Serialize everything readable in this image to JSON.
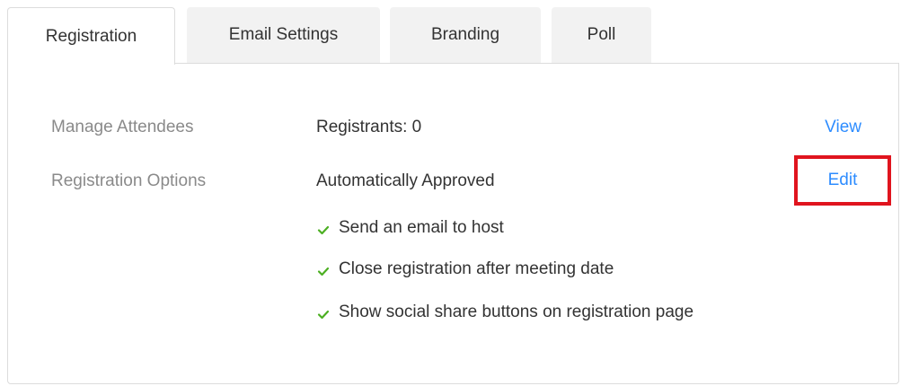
{
  "tabs": [
    {
      "label": "Registration",
      "active": true
    },
    {
      "label": "Email Settings",
      "active": false
    },
    {
      "label": "Branding",
      "active": false
    },
    {
      "label": "Poll",
      "active": false
    }
  ],
  "rows": {
    "manage": {
      "label": "Manage Attendees",
      "value": "Registrants: 0",
      "action": "View"
    },
    "options": {
      "label": "Registration Options",
      "value": "Automatically Approved",
      "action": "Edit"
    }
  },
  "options_list": [
    {
      "text": "Send an email to host",
      "icon": "check-icon"
    },
    {
      "text": "Close registration after meeting date",
      "icon": "check-icon"
    },
    {
      "text": "Show social share buttons on registration page",
      "icon": "check-icon"
    }
  ],
  "colors": {
    "link": "#2d8cff",
    "check": "#4caf22",
    "highlight": "#e0141e",
    "label": "#8a8a8a",
    "text": "#333333"
  }
}
